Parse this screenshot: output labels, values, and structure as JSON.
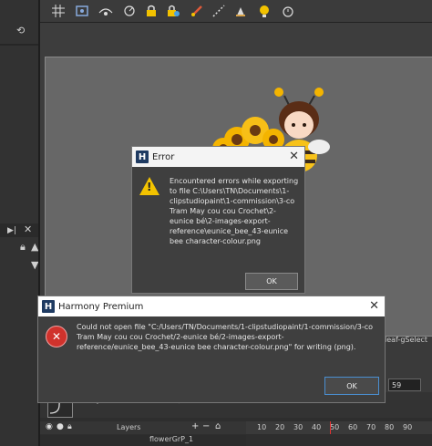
{
  "colors": {
    "dialog_bg": "#3f3f3f",
    "warning": "#f3c300",
    "error": "#d0322c",
    "ok_focus_border": "#4a8fd1",
    "stage": "#676767"
  },
  "toolbar": {
    "icons": [
      "grid-icon",
      "safe-area-icon",
      "onion-skin-icon",
      "rotate-icon",
      "lock-icon",
      "lock-all-icon",
      "brush-icon",
      "dashed-line-icon",
      "stamp-icon",
      "light-table-icon",
      "timer-icon"
    ]
  },
  "error_dialog": {
    "title": "Error",
    "message": "Encountered errors while exporting to file C:\\Users\\TN\\Documents\\1-clipstudiopaint\\1-commission\\3-co Tram May cou cou Crochet\\2-eunice bé\\2-images-export-reference\\eunice_bee_43-eunice bee character-colour.png",
    "ok_label": "OK",
    "icon": "warning-icon"
  },
  "harmony_dialog": {
    "title": "Harmony Premium",
    "message": "Could not open file \"C:/Users/TN/Documents/1-clipstudiopaint/1-commission/3-co Tram May cou cou Crochet/2-eunice bé/2-images-export-reference/eunice_bee_43-eunice bee character-colour.png\" for writing (png).",
    "ok_label": "OK",
    "icon": "error-icon"
  },
  "timeline": {
    "layers_label": "Layers",
    "layer_name": "flowerGrP_1",
    "frame_value": "59",
    "ruler_ticks": [
      "10",
      "20",
      "30",
      "40",
      "50",
      "60",
      "70",
      "80",
      "90"
    ],
    "side_label": "leaf-gSelect"
  }
}
